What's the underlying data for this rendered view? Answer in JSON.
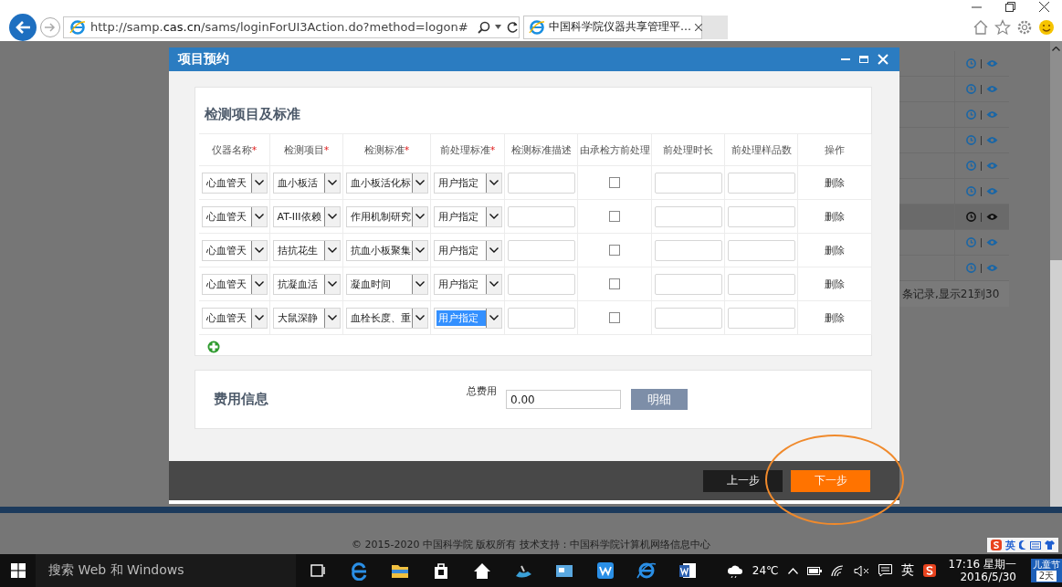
{
  "browser": {
    "url": "http://samp.**cas.cn**/sams/loginForUI3Action.do?method=logon#",
    "tab_title": "中国科学院仪器共享管理平…"
  },
  "background": {
    "action_rows": [
      {
        "highlighted": false
      },
      {
        "highlighted": false
      },
      {
        "highlighted": false
      },
      {
        "highlighted": false
      },
      {
        "highlighted": false
      },
      {
        "highlighted": false
      },
      {
        "highlighted": true
      },
      {
        "highlighted": false
      },
      {
        "highlighted": false
      }
    ],
    "pager_text": "条记录,显示21到30",
    "copyright": "© 2015-2020 中国科学院 版权所有 技术支持：中国科学院计算机网络信息中心",
    "ime_label": "英"
  },
  "dialog": {
    "title": "项目预约",
    "section_title": "检测项目及标准",
    "columns": [
      {
        "label": "仪器名称",
        "required_mark": "*"
      },
      {
        "label": "检测项目",
        "required_mark": "*"
      },
      {
        "label": "检测标准",
        "required_mark": "*"
      },
      {
        "label": "前处理标准",
        "required_mark": "*"
      },
      {
        "label": "检测标准描述"
      },
      {
        "label": "由承检方前处理"
      },
      {
        "label": "前处理时长"
      },
      {
        "label": "前处理样品数"
      },
      {
        "label": "操作"
      }
    ],
    "rows": [
      {
        "instrument": "心血管天",
        "test_item": "血小板活",
        "standard": "血小板活化标",
        "pretreatment": "用户指定",
        "pretreatment_focused": false,
        "checked": false,
        "action": "删除"
      },
      {
        "instrument": "心血管天",
        "test_item": "AT-III依赖",
        "standard": "作用机制研究",
        "pretreatment": "用户指定",
        "pretreatment_focused": false,
        "checked": false,
        "action": "删除"
      },
      {
        "instrument": "心血管天",
        "test_item": "拮抗花生",
        "standard": "抗血小板聚集",
        "pretreatment": "用户指定",
        "pretreatment_focused": false,
        "checked": false,
        "action": "删除"
      },
      {
        "instrument": "心血管天",
        "test_item": "抗凝血活",
        "standard": "凝血时间",
        "pretreatment": "用户指定",
        "pretreatment_focused": false,
        "checked": false,
        "action": "删除"
      },
      {
        "instrument": "心血管天",
        "test_item": "大鼠深静",
        "standard": "血栓长度、重",
        "pretreatment": "用户指定",
        "pretreatment_focused": true,
        "checked": false,
        "action": "删除"
      }
    ],
    "fee": {
      "title": "费用信息",
      "label": "总费用",
      "value": "0.00",
      "button": "明细"
    },
    "buttons": [
      {
        "label": "上一步",
        "kind": "secondary"
      },
      {
        "label": "下一步",
        "kind": "primary"
      }
    ]
  },
  "taskbar": {
    "search_placeholder": "搜索 Web 和 Windows",
    "temperature": "24℃",
    "ime": "英",
    "time": "17:16 星期一",
    "date": "2016/5/30",
    "holiday": "儿童节",
    "holiday_days": "2天"
  },
  "annotation": {
    "kind": "ellipse"
  }
}
